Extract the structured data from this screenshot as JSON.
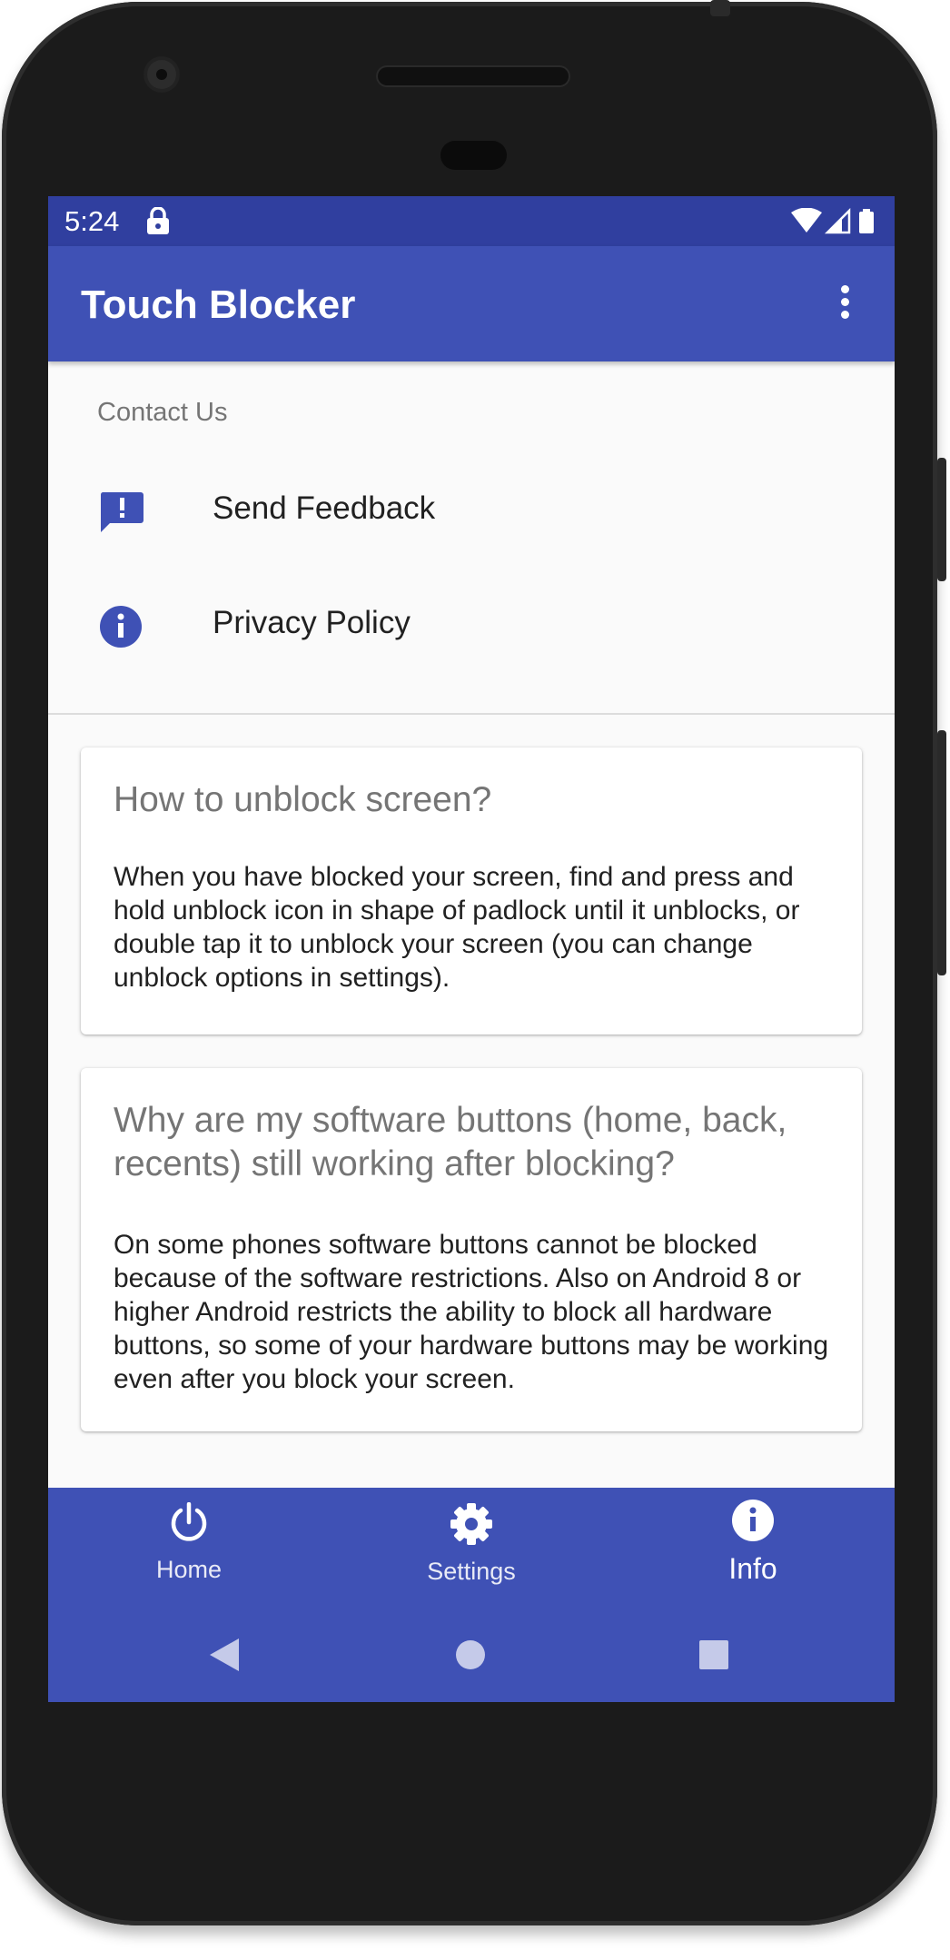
{
  "status_bar": {
    "time": "5:24"
  },
  "app_bar": {
    "title": "Touch Blocker"
  },
  "contact_section": {
    "header": "Contact Us",
    "items": [
      {
        "label": "Send Feedback",
        "icon": "feedback-icon"
      },
      {
        "label": "Privacy Policy",
        "icon": "info-icon"
      }
    ]
  },
  "cards": [
    {
      "question": "How to unblock screen?",
      "answer": "When you have blocked your screen, find and press and hold unblock icon in shape of padlock until it unblocks, or double tap it to unblock your screen (you can change unblock options in settings)."
    },
    {
      "question": "Why are my software buttons (home, back, recents) still working after blocking?",
      "answer": "On some phones software buttons cannot be blocked because of the software restrictions. Also on Android 8 or higher Android restricts the ability to block all hardware buttons, so some of your hardware buttons may be working even after you block your screen."
    }
  ],
  "bottom_nav": {
    "items": [
      {
        "label": "Home",
        "icon": "power-icon"
      },
      {
        "label": "Settings",
        "icon": "gear-icon"
      },
      {
        "label": "Info",
        "icon": "info-icon",
        "selected": true
      }
    ]
  },
  "colors": {
    "primary": "#3f51b5",
    "primary_dark": "#303f9f",
    "icon_accent": "#3f51b5"
  }
}
